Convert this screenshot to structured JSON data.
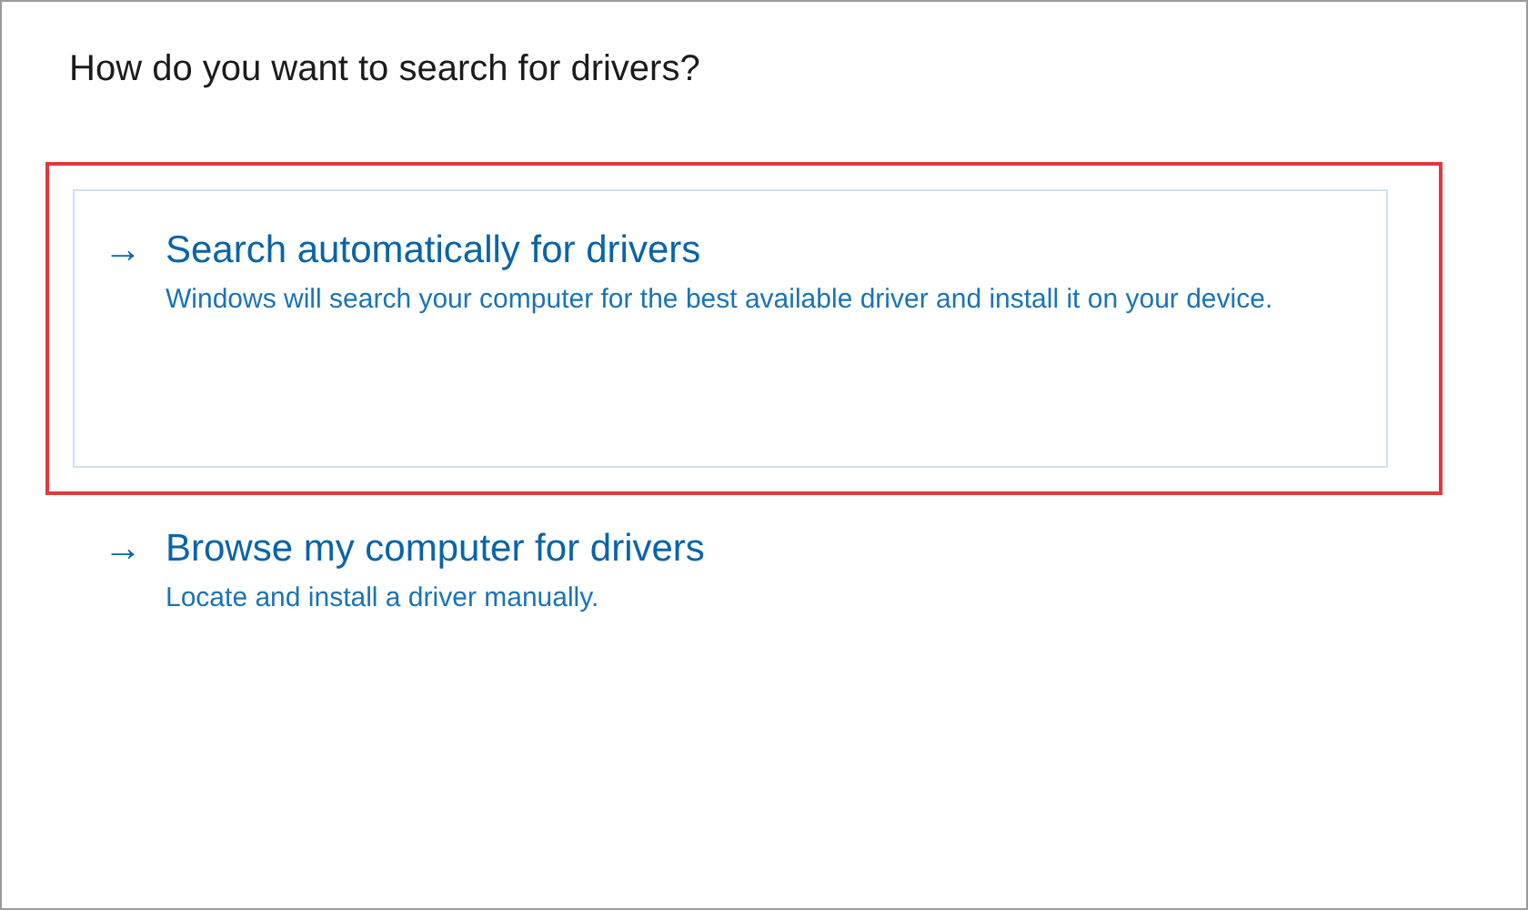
{
  "heading": "How do you want to search for drivers?",
  "options": [
    {
      "arrow": "→",
      "title": "Search automatically for drivers",
      "description": "Windows will search your computer for the best available driver and install it on your device.",
      "selected": true,
      "highlighted": true
    },
    {
      "arrow": "→",
      "title": "Browse my computer for drivers",
      "description": "Locate and install a driver manually.",
      "selected": false,
      "highlighted": false
    }
  ]
}
